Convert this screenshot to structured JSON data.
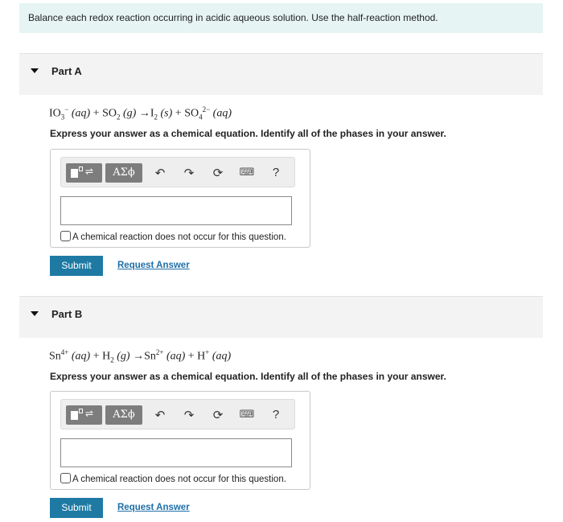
{
  "intro": "Balance each redox reaction occurring in acidic aqueous solution. Use the half-reaction method.",
  "toolbar": {
    "template_icon": "template-icon",
    "greek_label": "ΑΣϕ",
    "undo_glyph": "↶",
    "redo_glyph": "↷",
    "reset_glyph": "⟳",
    "keyboard_glyph": "⌨",
    "help_label": "?"
  },
  "no_reaction_label": "A chemical reaction does not occur for this question.",
  "submit_label": "Submit",
  "request_label": "Request Answer",
  "instruction": "Express your answer as a chemical equation. Identify all of the phases in your answer.",
  "parts": [
    {
      "title": "Part A",
      "equation": {
        "s1": "IO",
        "s1_sub": "3",
        "s1_sup": "−",
        "p1": "(aq)",
        "plus1": "+",
        "s2": "SO",
        "s2_sub": "2",
        "p2": "(g)",
        "arrow": "→",
        "s3": "I",
        "s3_sub": "2",
        "p3": "(s)",
        "plus2": "+",
        "s4": "SO",
        "s4_sub": "4",
        "s4_sup": "2−",
        "p4": "(aq)"
      },
      "answer_value": ""
    },
    {
      "title": "Part B",
      "equation": {
        "s1": "Sn",
        "s1_sup": "4+",
        "p1": "(aq)",
        "plus1": "+",
        "s2": "H",
        "s2_sub": "2",
        "p2": "(g)",
        "arrow": "→",
        "s3": "Sn",
        "s3_sup": "2+",
        "p3": "(aq)",
        "plus2": "+",
        "s4": "H",
        "s4_sup": "+",
        "p4": "(aq)"
      },
      "answer_value": ""
    }
  ]
}
